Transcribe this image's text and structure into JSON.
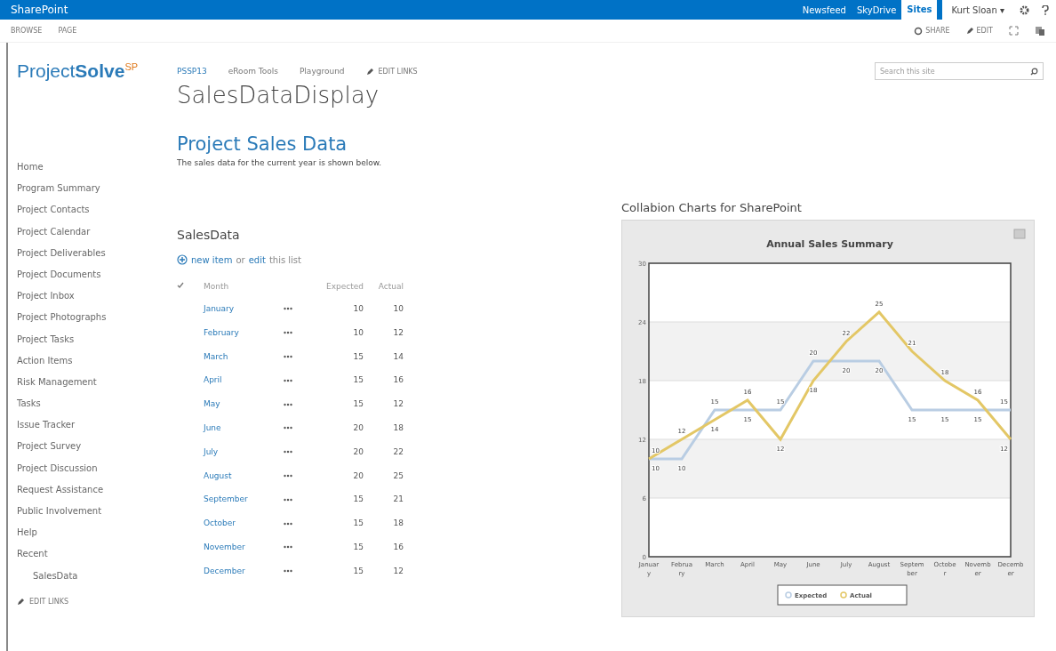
{
  "suite_bar": {
    "brand": "SharePoint",
    "links": [
      {
        "label": "Newsfeed",
        "selected": false
      },
      {
        "label": "SkyDrive",
        "selected": false
      },
      {
        "label": "Sites",
        "selected": true
      }
    ],
    "user": "Kurt Sloan ▾"
  },
  "ribbon": {
    "tabs": [
      "BROWSE",
      "PAGE"
    ],
    "actions": [
      {
        "kind": "share",
        "label": "SHARE"
      },
      {
        "kind": "edit",
        "label": "EDIT"
      }
    ]
  },
  "logo": {
    "main": "Project",
    "bold": "Solve",
    "sup": "SP"
  },
  "top_nav": {
    "links": [
      "PSSP13",
      "eRoom Tools",
      "Playground"
    ],
    "edit_links": "EDIT LINKS"
  },
  "site_title": "SalesDataDisplay",
  "search": {
    "placeholder": "Search this site"
  },
  "sidebar": {
    "items": [
      {
        "label": "Home"
      },
      {
        "label": "Program Summary"
      },
      {
        "label": "Project Contacts"
      },
      {
        "label": "Project Calendar"
      },
      {
        "label": "Project Deliverables"
      },
      {
        "label": "Project Documents"
      },
      {
        "label": "Project Inbox"
      },
      {
        "label": "Project Photographs"
      },
      {
        "label": "Project Tasks"
      },
      {
        "label": "Action Items"
      },
      {
        "label": "Risk Management"
      },
      {
        "label": "Tasks"
      },
      {
        "label": "Issue Tracker"
      },
      {
        "label": "Project Survey"
      },
      {
        "label": "Project Discussion"
      },
      {
        "label": "Request Assistance"
      },
      {
        "label": "Public Involvement"
      },
      {
        "label": "Help"
      },
      {
        "label": "Recent",
        "children": [
          {
            "label": "SalesData"
          }
        ]
      }
    ],
    "edit_links": "EDIT LINKS"
  },
  "page_heading": "Project Sales Data",
  "page_description": "The sales data for the current year is shown below.",
  "list": {
    "title": "SalesData",
    "new_item": "new item",
    "or_text": "or",
    "edit_link": "edit",
    "this_list": "this list",
    "columns": [
      "Month",
      "Expected",
      "Actual"
    ],
    "rows": [
      {
        "month": "January",
        "expected": "10",
        "actual": "10"
      },
      {
        "month": "February",
        "expected": "10",
        "actual": "12"
      },
      {
        "month": "March",
        "expected": "15",
        "actual": "14"
      },
      {
        "month": "April",
        "expected": "15",
        "actual": "16"
      },
      {
        "month": "May",
        "expected": "15",
        "actual": "12"
      },
      {
        "month": "June",
        "expected": "20",
        "actual": "18"
      },
      {
        "month": "July",
        "expected": "20",
        "actual": "22"
      },
      {
        "month": "August",
        "expected": "20",
        "actual": "25"
      },
      {
        "month": "September",
        "expected": "15",
        "actual": "21"
      },
      {
        "month": "October",
        "expected": "15",
        "actual": "18"
      },
      {
        "month": "November",
        "expected": "15",
        "actual": "16"
      },
      {
        "month": "December",
        "expected": "15",
        "actual": "12"
      }
    ]
  },
  "chart_webpart": {
    "title": "Collabion Charts for SharePoint",
    "chart_data": {
      "type": "line",
      "title": "Annual Sales Summary",
      "categories": [
        "January",
        "February",
        "March",
        "April",
        "May",
        "June",
        "July",
        "August",
        "September",
        "October",
        "November",
        "December"
      ],
      "series": [
        {
          "name": "Expected",
          "color": "#b9cde3",
          "values": [
            10,
            10,
            15,
            15,
            15,
            20,
            20,
            20,
            15,
            15,
            15,
            15
          ],
          "value_labels": [
            "10",
            "10",
            "15",
            "15",
            "15",
            "20",
            "20",
            "20",
            "15",
            "15",
            "15",
            "15"
          ]
        },
        {
          "name": "Actual",
          "color": "#e3c766",
          "values": [
            10,
            12,
            14,
            16,
            12,
            18,
            22,
            25,
            21,
            18,
            16,
            12
          ],
          "value_labels": [
            "10",
            "12",
            "14",
            "16",
            "12",
            "18",
            "22",
            "25",
            "21",
            "18",
            "16",
            "12"
          ]
        }
      ],
      "ylim": [
        0,
        30
      ],
      "yticks": [
        {
          "value": 0,
          "label": "0"
        },
        {
          "value": 6,
          "label": "6"
        },
        {
          "value": 12,
          "label": "12"
        },
        {
          "value": 18,
          "label": "18"
        },
        {
          "value": 24,
          "label": "24"
        },
        {
          "value": 30,
          "label": "30"
        }
      ],
      "grid": true,
      "legend": true
    }
  }
}
